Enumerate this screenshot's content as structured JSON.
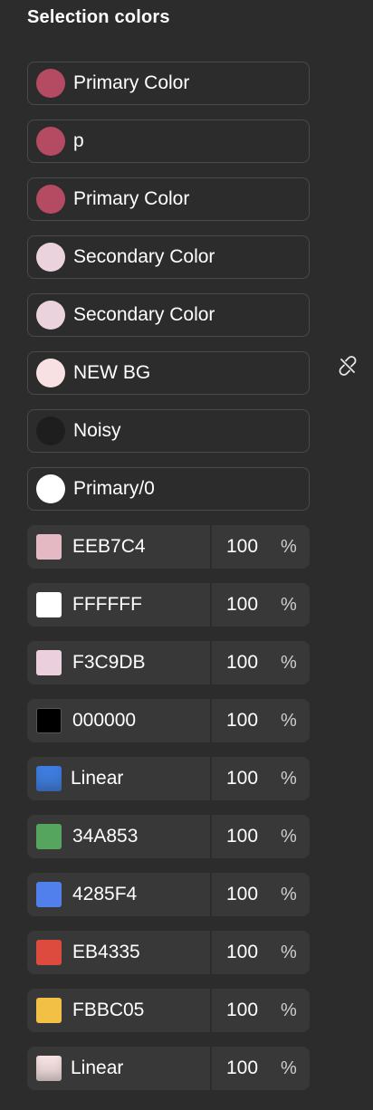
{
  "panel": {
    "title": "Selection colors"
  },
  "styles": [
    {
      "label": "Primary Color",
      "color": "#b54a63"
    },
    {
      "label": "p",
      "color": "#b54a63"
    },
    {
      "label": "Primary Color",
      "color": "#b54a63"
    },
    {
      "label": "Secondary Color",
      "color": "#ead3dc"
    },
    {
      "label": "Secondary Color",
      "color": "#ead3dc"
    },
    {
      "label": "NEW BG",
      "color": "#f7e1e3",
      "detach_icon": "detach-link-icon"
    },
    {
      "label": "Noisy",
      "color": "#1e1e1e"
    },
    {
      "label": "Primary/0",
      "color": "#ffffff"
    }
  ],
  "colors": [
    {
      "hex": "EEB7C4",
      "opacity": "100",
      "unit": "%",
      "color": "#e4b9c4"
    },
    {
      "hex": "FFFFFF",
      "opacity": "100",
      "unit": "%",
      "color": "#ffffff"
    },
    {
      "hex": "F3C9DB",
      "opacity": "100",
      "unit": "%",
      "color": "#ebcfdc"
    },
    {
      "hex": "000000",
      "opacity": "100",
      "unit": "%",
      "color": "#000000"
    },
    {
      "hex": "Linear",
      "opacity": "100",
      "unit": "%",
      "color": "#3d7fe6",
      "gradient": true
    },
    {
      "hex": "34A853",
      "opacity": "100",
      "unit": "%",
      "color": "#55a55f"
    },
    {
      "hex": "4285F4",
      "opacity": "100",
      "unit": "%",
      "color": "#5180ec"
    },
    {
      "hex": "EB4335",
      "opacity": "100",
      "unit": "%",
      "color": "#dc4b3e"
    },
    {
      "hex": "FBBC05",
      "opacity": "100",
      "unit": "%",
      "color": "#f2c044"
    },
    {
      "hex": "Linear",
      "opacity": "100",
      "unit": "%",
      "color": "#f9e4e4",
      "gradient": true
    }
  ]
}
